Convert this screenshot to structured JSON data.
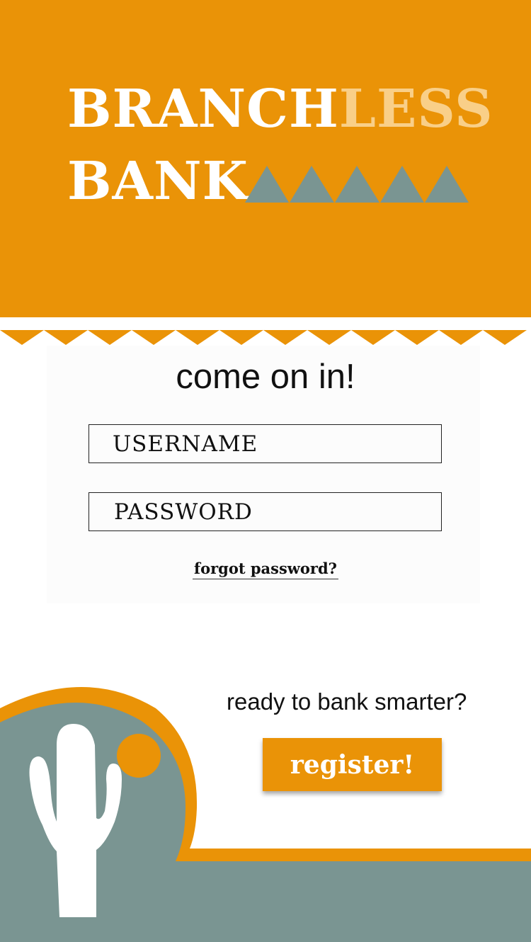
{
  "logo": {
    "line1_white": "BRANCH",
    "line1_light": "LESS",
    "line2": "BANK"
  },
  "login": {
    "title": "come on in!",
    "username_placeholder": "USERNAME",
    "password_placeholder": "PASSWORD",
    "forgot_link": "forgot password?"
  },
  "signup": {
    "tagline": "ready to bank smarter?",
    "register_label": "register!"
  },
  "colors": {
    "brand_orange": "#ea9307",
    "light_orange": "#f9cf88",
    "slate_gray": "#7a9592",
    "white": "#ffffff"
  }
}
